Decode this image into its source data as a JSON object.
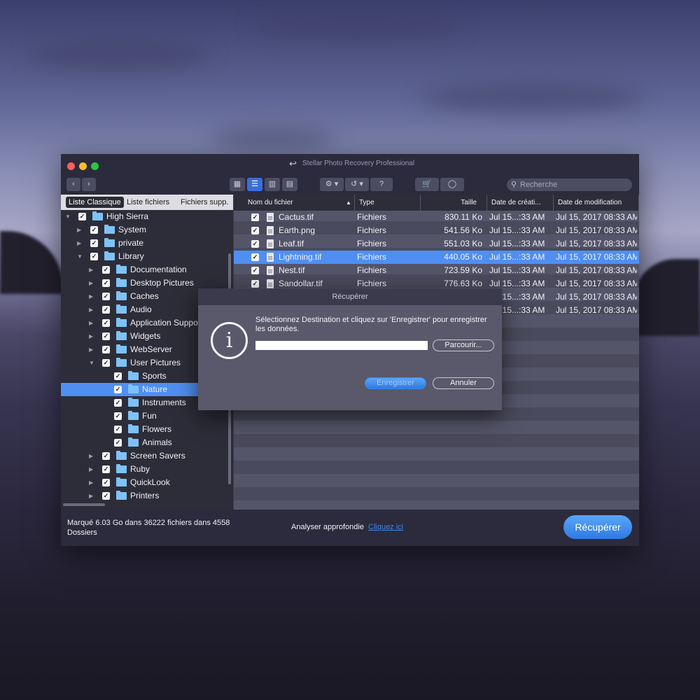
{
  "app": {
    "title": "Stellar Photo Recovery Professional"
  },
  "toolbar": {
    "views": [
      "grid",
      "list",
      "columns",
      "coverflow"
    ],
    "active_view": "list",
    "help_label": "?",
    "search_placeholder": "Recherche"
  },
  "left_tabs": [
    {
      "label": "Liste Classique",
      "active": true
    },
    {
      "label": "Liste fichiers",
      "active": false
    },
    {
      "label": "Fichiers supp.",
      "active": false
    }
  ],
  "tree": [
    {
      "label": "High Sierra",
      "level": 0,
      "expanded": true,
      "selected": false
    },
    {
      "label": "System",
      "level": 1,
      "expanded": false,
      "selected": false
    },
    {
      "label": "private",
      "level": 1,
      "expanded": false,
      "selected": false
    },
    {
      "label": "Library",
      "level": 1,
      "expanded": true,
      "selected": false
    },
    {
      "label": "Documentation",
      "level": 2,
      "expanded": false,
      "selected": false
    },
    {
      "label": "Desktop Pictures",
      "level": 2,
      "expanded": false,
      "selected": false
    },
    {
      "label": "Caches",
      "level": 2,
      "expanded": false,
      "selected": false
    },
    {
      "label": "Audio",
      "level": 2,
      "expanded": false,
      "selected": false
    },
    {
      "label": "Application Support",
      "level": 2,
      "expanded": false,
      "selected": false
    },
    {
      "label": "Widgets",
      "level": 2,
      "expanded": false,
      "selected": false
    },
    {
      "label": "WebServer",
      "level": 2,
      "expanded": false,
      "selected": false
    },
    {
      "label": "User Pictures",
      "level": 2,
      "expanded": true,
      "selected": false
    },
    {
      "label": "Sports",
      "level": 3,
      "expanded": false,
      "selected": false
    },
    {
      "label": "Nature",
      "level": 3,
      "expanded": false,
      "selected": true
    },
    {
      "label": "Instruments",
      "level": 3,
      "expanded": false,
      "selected": false
    },
    {
      "label": "Fun",
      "level": 3,
      "expanded": false,
      "selected": false
    },
    {
      "label": "Flowers",
      "level": 3,
      "expanded": false,
      "selected": false
    },
    {
      "label": "Animals",
      "level": 3,
      "expanded": false,
      "selected": false
    },
    {
      "label": "Screen Savers",
      "level": 2,
      "expanded": false,
      "selected": false
    },
    {
      "label": "Ruby",
      "level": 2,
      "expanded": false,
      "selected": false
    },
    {
      "label": "QuickLook",
      "level": 2,
      "expanded": false,
      "selected": false
    },
    {
      "label": "Printers",
      "level": 2,
      "expanded": false,
      "selected": false
    }
  ],
  "columns": [
    "Nom du fichier",
    "Type",
    "Taille",
    "Date de créati...",
    "Date de modification"
  ],
  "sort_indicator": "▲",
  "files": [
    {
      "name": "Cactus.tif",
      "type": "Fichiers",
      "size": "830.11 Ko",
      "created": "Jul 15...:33 AM",
      "modified": "Jul 15, 2017 08:33 AM",
      "selected": false
    },
    {
      "name": "Earth.png",
      "type": "Fichiers",
      "size": "541.56 Ko",
      "created": "Jul 15...:33 AM",
      "modified": "Jul 15, 2017 08:33 AM",
      "selected": false
    },
    {
      "name": "Leaf.tif",
      "type": "Fichiers",
      "size": "551.03 Ko",
      "created": "Jul 15...:33 AM",
      "modified": "Jul 15, 2017 08:33 AM",
      "selected": false
    },
    {
      "name": "Lightning.tif",
      "type": "Fichiers",
      "size": "440.05 Ko",
      "created": "Jul 15...:33 AM",
      "modified": "Jul 15, 2017 08:33 AM",
      "selected": true
    },
    {
      "name": "Nest.tif",
      "type": "Fichiers",
      "size": "723.59 Ko",
      "created": "Jul 15...:33 AM",
      "modified": "Jul 15, 2017 08:33 AM",
      "selected": false
    },
    {
      "name": "Sandollar.tif",
      "type": "Fichiers",
      "size": "776.63 Ko",
      "created": "Jul 15...:33 AM",
      "modified": "Jul 15, 2017 08:33 AM",
      "selected": false
    },
    {
      "name": "",
      "type": "",
      "size": "",
      "created": "Jul 15...:33 AM",
      "modified": "Jul 15, 2017 08:33 AM",
      "selected": false
    },
    {
      "name": "",
      "type": "",
      "size": "",
      "created": "Jul 15...:33 AM",
      "modified": "Jul 15, 2017 08:33 AM",
      "selected": false
    }
  ],
  "bottom": {
    "status": "Marqué 6.03 Go dans 36222 fichiers dans 4558 Dossiers",
    "deep_scan_label": "Analyser approfondie",
    "deep_scan_link": "Cliquez ici",
    "recover_label": "Récupérer"
  },
  "dialog": {
    "title": "Récupérer",
    "message": "Sélectionnez Destination et cliquez sur 'Enregistrer' pour enregistrer les données.",
    "path_value": "",
    "browse_label": "Parcourir...",
    "save_label": "Enregistrer",
    "cancel_label": "Annuler"
  }
}
